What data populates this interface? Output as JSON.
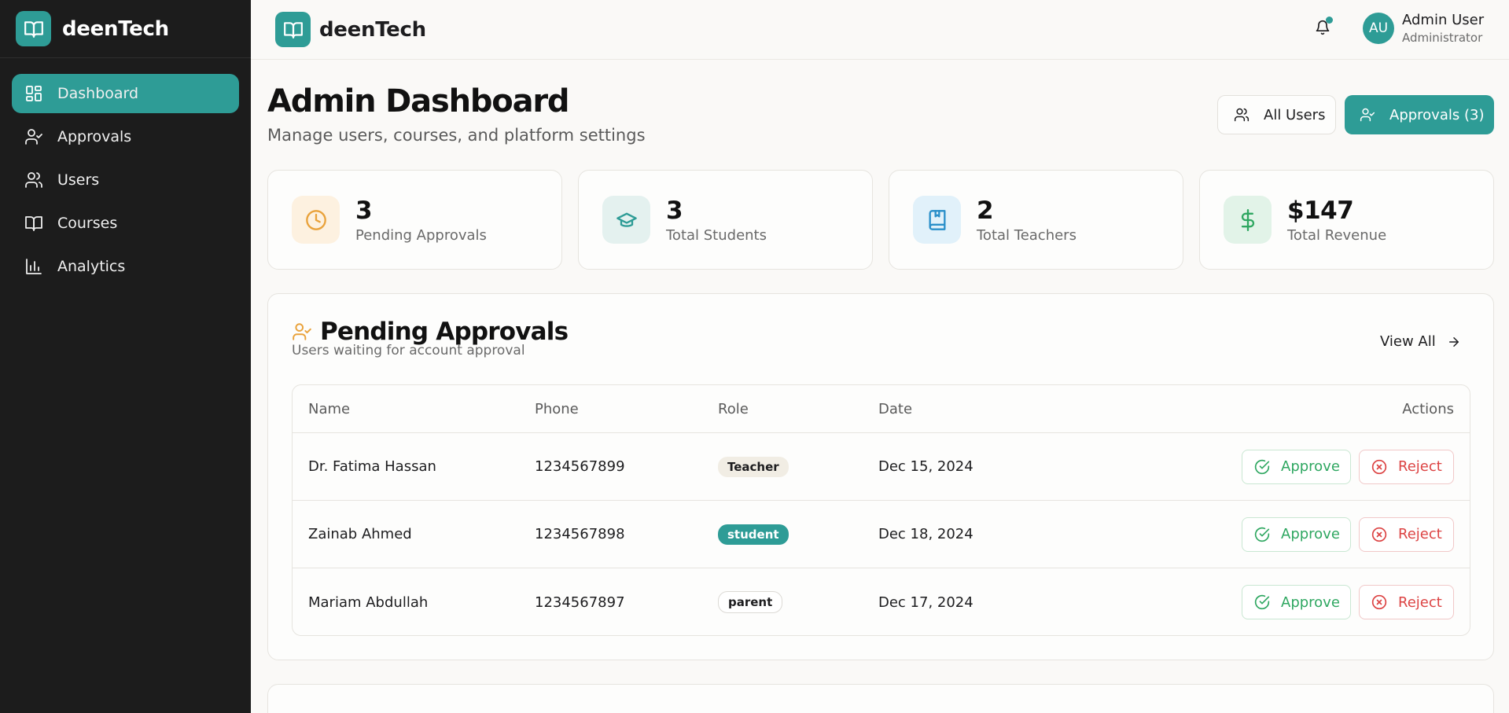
{
  "app": {
    "brand": "deenTech"
  },
  "sidebar": {
    "items": [
      {
        "label": "Dashboard",
        "icon": "dashboard-icon",
        "active": true
      },
      {
        "label": "Approvals",
        "icon": "user-check-icon",
        "active": false
      },
      {
        "label": "Users",
        "icon": "users-icon",
        "active": false
      },
      {
        "label": "Courses",
        "icon": "book-open-icon",
        "active": false
      },
      {
        "label": "Analytics",
        "icon": "bar-chart-icon",
        "active": false
      }
    ]
  },
  "topbar": {
    "brand": "deenTech",
    "notifications_icon": "bell-icon",
    "user": {
      "initials": "AU",
      "name": "Admin User",
      "role": "Administrator"
    }
  },
  "header": {
    "title": "Admin Dashboard",
    "subtitle": "Manage users, courses, and platform settings",
    "all_users_label": "All Users",
    "approvals_label": "Approvals (3)"
  },
  "stats": [
    {
      "value": "3",
      "label": "Pending Approvals",
      "icon": "clock-icon",
      "color": "#e9a23b",
      "bg": "#fdf1e0"
    },
    {
      "value": "3",
      "label": "Total Students",
      "icon": "graduation-cap-icon",
      "color": "#2e9c96",
      "bg": "#e4f1ef"
    },
    {
      "value": "2",
      "label": "Total Teachers",
      "icon": "book-icon",
      "color": "#2a8fc9",
      "bg": "#e1f1fa"
    },
    {
      "value": "$147",
      "label": "Total Revenue",
      "icon": "dollar-icon",
      "color": "#2fa761",
      "bg": "#e2f3e8"
    }
  ],
  "pending": {
    "title": "Pending Approvals",
    "subtitle": "Users waiting for account approval",
    "view_all": "View All",
    "columns": [
      "Name",
      "Phone",
      "Role",
      "Date",
      "Actions"
    ],
    "approve_label": "Approve",
    "reject_label": "Reject",
    "rows": [
      {
        "name": "Dr. Fatima Hassan",
        "phone": "1234567899",
        "role": "Teacher",
        "date": "Dec 15, 2024"
      },
      {
        "name": "Zainab Ahmed",
        "phone": "1234567898",
        "role": "student",
        "date": "Dec 18, 2024"
      },
      {
        "name": "Mariam Abdullah",
        "phone": "1234567897",
        "role": "parent",
        "date": "Dec 17, 2024"
      }
    ]
  },
  "colors": {
    "accent": "#2e9c96",
    "sidebar_bg": "#1c1c1c",
    "approve": "#2fa761",
    "reject": "#dc4343"
  }
}
